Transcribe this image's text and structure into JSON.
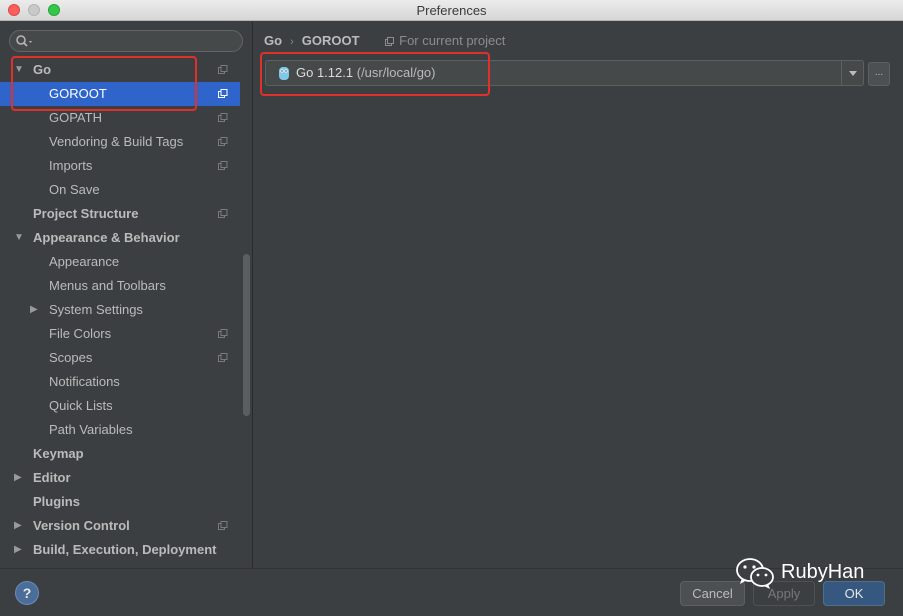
{
  "window": {
    "title": "Preferences"
  },
  "search": {
    "placeholder": ""
  },
  "tree": [
    {
      "label": "Go",
      "level": 0,
      "arrow": "▼",
      "bold": true,
      "copy": true
    },
    {
      "label": "GOROOT",
      "level": 1,
      "arrow": "",
      "bold": false,
      "copy": true,
      "selected": true
    },
    {
      "label": "GOPATH",
      "level": 1,
      "arrow": "",
      "bold": false,
      "copy": true
    },
    {
      "label": "Vendoring & Build Tags",
      "level": 1,
      "arrow": "",
      "bold": false,
      "copy": true
    },
    {
      "label": "Imports",
      "level": 1,
      "arrow": "",
      "bold": false,
      "copy": true
    },
    {
      "label": "On Save",
      "level": 1,
      "arrow": "",
      "bold": false,
      "copy": false
    },
    {
      "label": "Project Structure",
      "level": 0,
      "arrow": "",
      "bold": true,
      "copy": true
    },
    {
      "label": "Appearance & Behavior",
      "level": 0,
      "arrow": "▼",
      "bold": true,
      "copy": false
    },
    {
      "label": "Appearance",
      "level": 1,
      "arrow": "",
      "bold": false,
      "copy": false
    },
    {
      "label": "Menus and Toolbars",
      "level": 1,
      "arrow": "",
      "bold": false,
      "copy": false
    },
    {
      "label": "System Settings",
      "level": 1,
      "arrow": "▶",
      "bold": false,
      "copy": false
    },
    {
      "label": "File Colors",
      "level": 1,
      "arrow": "",
      "bold": false,
      "copy": true
    },
    {
      "label": "Scopes",
      "level": 1,
      "arrow": "",
      "bold": false,
      "copy": true
    },
    {
      "label": "Notifications",
      "level": 1,
      "arrow": "",
      "bold": false,
      "copy": false
    },
    {
      "label": "Quick Lists",
      "level": 1,
      "arrow": "",
      "bold": false,
      "copy": false
    },
    {
      "label": "Path Variables",
      "level": 1,
      "arrow": "",
      "bold": false,
      "copy": false
    },
    {
      "label": "Keymap",
      "level": 0,
      "arrow": "",
      "bold": true,
      "copy": false
    },
    {
      "label": "Editor",
      "level": 0,
      "arrow": "▶",
      "bold": true,
      "copy": false
    },
    {
      "label": "Plugins",
      "level": 0,
      "arrow": "",
      "bold": true,
      "copy": false
    },
    {
      "label": "Version Control",
      "level": 0,
      "arrow": "▶",
      "bold": true,
      "copy": true
    },
    {
      "label": "Build, Execution, Deployment",
      "level": 0,
      "arrow": "▶",
      "bold": true,
      "copy": false
    }
  ],
  "breadcrumb": {
    "parent": "Go",
    "current": "GOROOT",
    "scope": "For current project"
  },
  "sdk": {
    "name": "Go 1.12.1",
    "path": "(/usr/local/go)",
    "more_label": "..."
  },
  "footer": {
    "help_label": "?",
    "cancel_label": "Cancel",
    "apply_label": "Apply",
    "ok_label": "OK"
  },
  "watermark": {
    "text": "RubyHan"
  },
  "colors": {
    "selection": "#2f65ca",
    "highlight_box": "#e0302a",
    "ok_button": "#365880"
  }
}
